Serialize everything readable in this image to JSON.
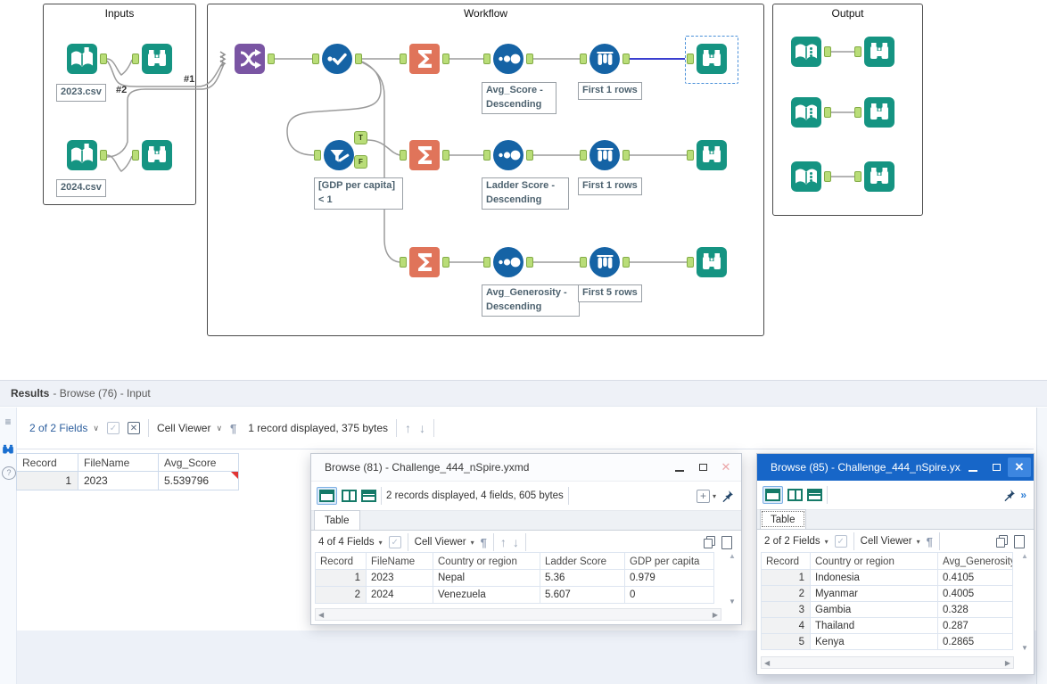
{
  "glyphs": {
    "chevron": "∨",
    "dropdown": "▾",
    "pilcrow": "¶",
    "arrow_up": "↑",
    "arrow_down": "↓",
    "tri_up": "▲",
    "tri_down": "▼",
    "tri_left": "◀",
    "tri_right": "▶",
    "close": "✕",
    "check": "✓",
    "cross": "✕",
    "plus": "+",
    "more": "»",
    "help": "?",
    "list": "≡",
    "t": "T",
    "f": "F"
  },
  "canvas": {
    "containers": {
      "inputs": "Inputs",
      "workflow": "Workflow",
      "output": "Output"
    },
    "annotations": {
      "input_2023": "2023.csv",
      "input_2024": "2024.csv",
      "conn1": "#1",
      "conn2": "#2",
      "filter_line1": "[GDP per capita]",
      "filter_line2": "< 1",
      "sort1": "Avg_Score - Descending",
      "sample1": "First 1 rows",
      "sort2": "Ladder Score - Descending",
      "sample2": "First 1 rows",
      "sort3": "Avg_Generosity - Descending",
      "sample3": "First 5 rows"
    }
  },
  "results_panel": {
    "title": "Results",
    "context": "- Browse (76) - Input",
    "fields_label": "2 of 2 Fields",
    "cell_viewer_label": "Cell Viewer",
    "record_info": "1 record displayed, 375 bytes",
    "table": {
      "columns": [
        "Record",
        "FileName",
        "Avg_Score"
      ],
      "rows": [
        [
          "1",
          "2023",
          "5.539796"
        ]
      ]
    }
  },
  "browse81": {
    "title": "Browse (81) - Challenge_444_nSpire.yxmd",
    "record_info": "2 records displayed, 4 fields, 605 bytes",
    "tab_label": "Table",
    "fields_label": "4 of 4 Fields",
    "cell_viewer_label": "Cell Viewer",
    "table": {
      "columns": [
        "Record",
        "FileName",
        "Country or region",
        "Ladder Score",
        "GDP per capita"
      ],
      "rows": [
        [
          "1",
          "2023",
          "Nepal",
          "5.36",
          "0.979"
        ],
        [
          "2",
          "2024",
          "Venezuela",
          "5.607",
          "0"
        ]
      ]
    }
  },
  "browse85": {
    "title": "Browse (85) - Challenge_444_nSpire.yx...",
    "tab_label": "Table",
    "fields_label": "2 of 2 Fields",
    "cell_viewer_label": "Cell Viewer",
    "table": {
      "columns": [
        "Record",
        "Country or region",
        "Avg_Generosity"
      ],
      "rows": [
        [
          "1",
          "Indonesia",
          "0.4105"
        ],
        [
          "2",
          "Myanmar",
          "0.4005"
        ],
        [
          "3",
          "Gambia",
          "0.328"
        ],
        [
          "4",
          "Thailand",
          "0.287"
        ],
        [
          "5",
          "Kenya",
          "0.2865"
        ]
      ]
    }
  },
  "colors": {
    "tool_teal": "#159482",
    "tool_blue": "#1563A5",
    "tool_orange": "#E0745A",
    "tool_purple": "#7A55A3",
    "anchor_green": "#B9DD78",
    "selected_wire": "#3A3FD0",
    "active_titlebar": "#1766C8",
    "annotation_text": "#4D626F"
  }
}
